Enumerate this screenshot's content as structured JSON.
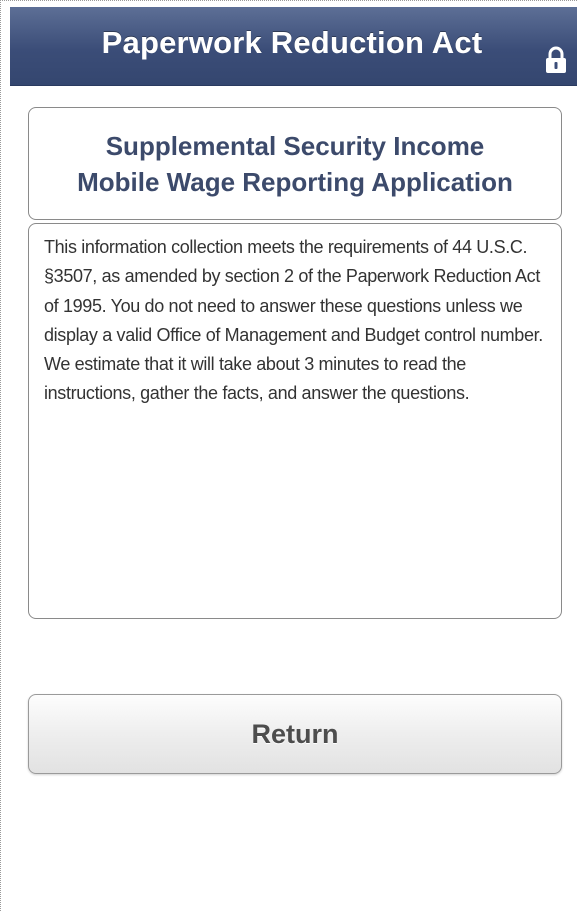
{
  "header": {
    "title": "Paperwork Reduction Act",
    "lock_icon": "lock-icon"
  },
  "title_card": {
    "line1": "Supplemental Security Income",
    "line2": "Mobile Wage Reporting Application"
  },
  "info": {
    "text": "This information collection meets the requirements of 44 U.S.C. §3507, as amended by section 2 of the Paperwork Reduction Act of 1995.  You do not need to answer these questions unless we display a valid Office of Management and Budget control number. We estimate that it will take about 3 minutes to read the instructions, gather the facts, and answer the questions."
  },
  "actions": {
    "return_label": "Return"
  },
  "colors": {
    "header_bg": "#3b4d78",
    "title_text": "#3c4a6b",
    "body_text": "#333333",
    "button_text": "#4d4d4d"
  }
}
